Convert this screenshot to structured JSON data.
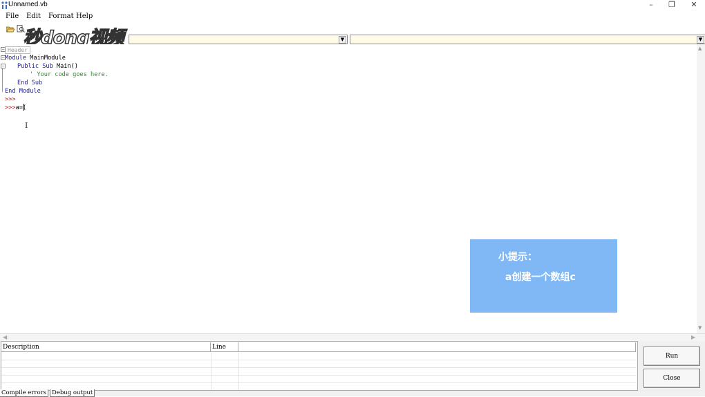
{
  "window": {
    "title": "Unnamed.vb",
    "minimize": "–",
    "restore": "❐",
    "close": "✕"
  },
  "menu": {
    "items": [
      "File",
      "Edit",
      "Format",
      "Help"
    ]
  },
  "watermark": {
    "text": "秒dong视频"
  },
  "editor": {
    "header_tag": "Header",
    "lines": [
      {
        "kw1": "Module",
        "rest": " MainModule"
      },
      {
        "kw1": "Public Sub",
        "rest": " Main()"
      },
      {
        "comment": "' Your code goes here."
      },
      {
        "kw1": "End Sub"
      },
      {
        "kw1": "End Module"
      },
      {
        "prompt": ">>>"
      },
      {
        "prompt": ">>>",
        "input": "a=("
      }
    ]
  },
  "tip": {
    "title": "小提示：",
    "body": "a创建一个数组c"
  },
  "error_grid": {
    "columns": [
      "Description",
      "Line",
      ""
    ]
  },
  "tabs": [
    "Compile errors",
    "Debug output"
  ],
  "buttons": {
    "run": "Run",
    "close": "Close"
  },
  "colors": {
    "keyword": "#1a1a9a",
    "comment": "#2e8b2e",
    "prompt": "#b22222",
    "tip_bg": "#7fb8f5",
    "combo_bg": "#fffbe6"
  }
}
